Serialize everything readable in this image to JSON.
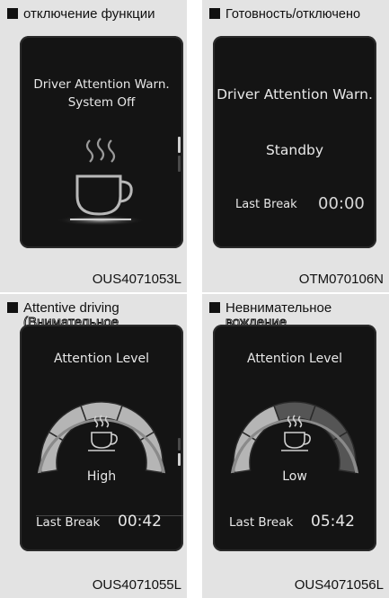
{
  "panels": [
    {
      "heading": "отключение функции",
      "screen_line1": "Driver Attention Warn.",
      "screen_line2": "System Off",
      "icon": "coffee-cup-icon",
      "caption": "OUS4071053L"
    },
    {
      "heading": "Готовность/отключено",
      "screen_title": "Driver Attention Warn.",
      "screen_status": "Standby",
      "last_break_label": "Last Break",
      "last_break_value": "00:00",
      "caption": "OTM070106N"
    },
    {
      "heading_main": "Attentive driving",
      "heading_outlined": "(Внимательное\nвождение)",
      "level_title": "Attention Level",
      "level_value": "High",
      "level_fraction": 1.0,
      "last_break_label": "Last Break",
      "last_break_value": "00:42",
      "caption": "OUS4071055L"
    },
    {
      "heading_main": "Невнимательное",
      "heading_outlined": "вождение",
      "level_title": "Attention Level",
      "level_value": "Low",
      "level_fraction": 0.4,
      "last_break_label": "Last Break",
      "last_break_value": "05:42",
      "caption": "OUS4071056L"
    }
  ]
}
